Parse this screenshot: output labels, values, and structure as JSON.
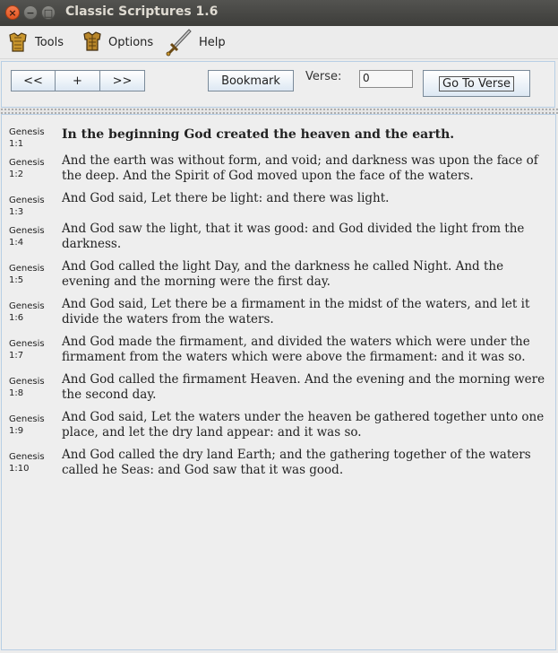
{
  "window": {
    "title": "Classic Scriptures 1.6",
    "close": "×",
    "minimize": "−",
    "maximize": "□"
  },
  "menu": {
    "items": [
      {
        "label": "Tools",
        "icon": "armor-icon"
      },
      {
        "label": "Options",
        "icon": "shield-icon"
      },
      {
        "label": "Help",
        "icon": "sword-icon"
      }
    ]
  },
  "toolbar": {
    "prev_label": "<<",
    "add_label": "+",
    "next_label": ">>",
    "bookmark_label": "Bookmark",
    "verse_label": "Verse:",
    "verse_value": "0",
    "goto_label": "Go To Verse"
  },
  "verses": [
    {
      "book": "Genesis",
      "ref": "1:1",
      "text": "In the beginning God created the heaven and the earth."
    },
    {
      "book": "Genesis",
      "ref": "1:2",
      "text": "And the earth was without form, and void; and darkness was upon the face of the deep. And the Spirit of God moved upon the face of the waters."
    },
    {
      "book": "Genesis",
      "ref": "1:3",
      "text": "And God said, Let there be light: and there was light."
    },
    {
      "book": "Genesis",
      "ref": "1:4",
      "text": "And God saw the light, that it was good: and God divided the light from the darkness."
    },
    {
      "book": "Genesis",
      "ref": "1:5",
      "text": "And God called the light Day, and the darkness he called Night. And the evening and the morning were the first day."
    },
    {
      "book": "Genesis",
      "ref": "1:6",
      "text": "And God said, Let there be a firmament in the midst of the waters, and let it divide the waters from the waters."
    },
    {
      "book": "Genesis",
      "ref": "1:7",
      "text": "And God made the firmament, and divided the waters which were under the firmament from the waters which were above the firmament: and it was so."
    },
    {
      "book": "Genesis",
      "ref": "1:8",
      "text": "And God called the firmament Heaven. And the evening and the morning were the second day."
    },
    {
      "book": "Genesis",
      "ref": "1:9",
      "text": "And God said, Let the waters under the heaven be gathered together unto one place, and let the dry land appear: and it was so."
    },
    {
      "book": "Genesis",
      "ref": "1:10",
      "text": "And God called the dry land Earth; and the gathering together of the waters called he Seas: and God saw that it was good."
    }
  ]
}
